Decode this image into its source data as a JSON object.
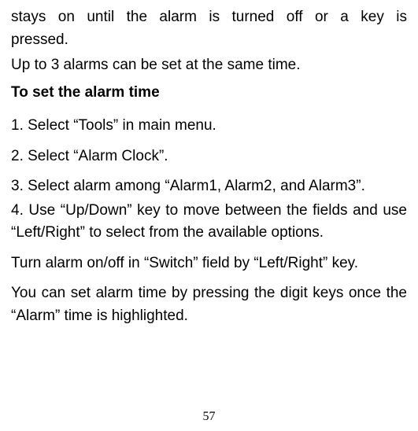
{
  "intro": {
    "line1": "stays on until the alarm is turned off or a key is",
    "line2": "pressed.",
    "line3": "Up to 3 alarms can be set at the same time."
  },
  "heading": "To set the alarm time",
  "steps": {
    "s1": "1. Select “Tools” in main menu.",
    "s2": "2. Select “Alarm Clock”.",
    "s3": "3. Select alarm among “Alarm1, Alarm2, and Alarm3”.",
    "s4": "4. Use “Up/Down” key to move between the fields and use “Left/Right” to select from the available options."
  },
  "notes": {
    "n1": "Turn alarm on/off in “Switch” field by “Left/Right” key.",
    "n2": "You can set alarm time by pressing the digit keys once the “Alarm” time is highlighted."
  },
  "pageNumber": "57"
}
